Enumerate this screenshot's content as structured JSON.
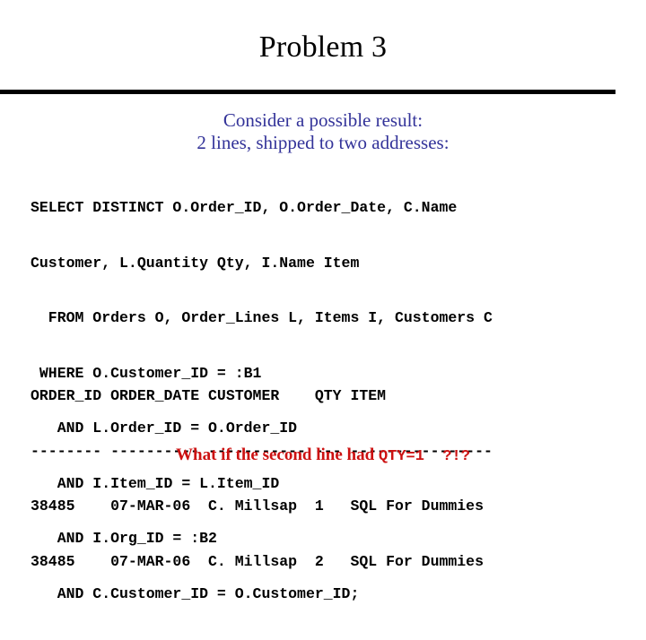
{
  "slide": {
    "title": "Problem 3",
    "divider_color": "#000000",
    "subtitle": {
      "color": "#333399",
      "lines": [
        "Consider a possible result:",
        "2 lines, shipped to two addresses:"
      ]
    },
    "sql_block": {
      "color": "#000000",
      "lines": [
        "SELECT DISTINCT O.Order_ID, O.Order_Date, C.Name",
        "Customer, L.Quantity Qty, I.Name Item",
        "  FROM Orders O, Order_Lines L, Items I, Customers C",
        " WHERE O.Customer_ID = :B1",
        "   AND L.Order_ID = O.Order_ID",
        "   AND I.Item_ID = L.Item_ID",
        "   AND I.Org_ID = :B2",
        "   AND C.Customer_ID = O.Customer_ID;"
      ]
    },
    "result_block": {
      "color": "#000000",
      "columns": [
        "ORDER_ID",
        "ORDER_DATE",
        "CUSTOMER",
        "QTY",
        "ITEM"
      ],
      "header_line": "ORDER_ID ORDER_DATE CUSTOMER    QTY ITEM",
      "separator_line": "-------- ---------- ----------- --- ----------------",
      "rows": [
        {
          "order_id": "38485",
          "order_date": "07-MAR-06",
          "customer": "C. Millsap",
          "qty": "1",
          "item": "SQL For Dummies",
          "text": "38485    07-MAR-06  C. Millsap  1   SQL For Dummies"
        },
        {
          "order_id": "38485",
          "order_date": "07-MAR-06",
          "customer": "C. Millsap",
          "qty": "2",
          "item": "SQL For Dummies",
          "text": "38485    07-MAR-06  C. Millsap  2   SQL For Dummies"
        }
      ]
    },
    "bottom_note": {
      "color": "#cc1111",
      "serif_text": "What if the second line had ",
      "mono_text": "QTY=1  ?!?"
    }
  }
}
